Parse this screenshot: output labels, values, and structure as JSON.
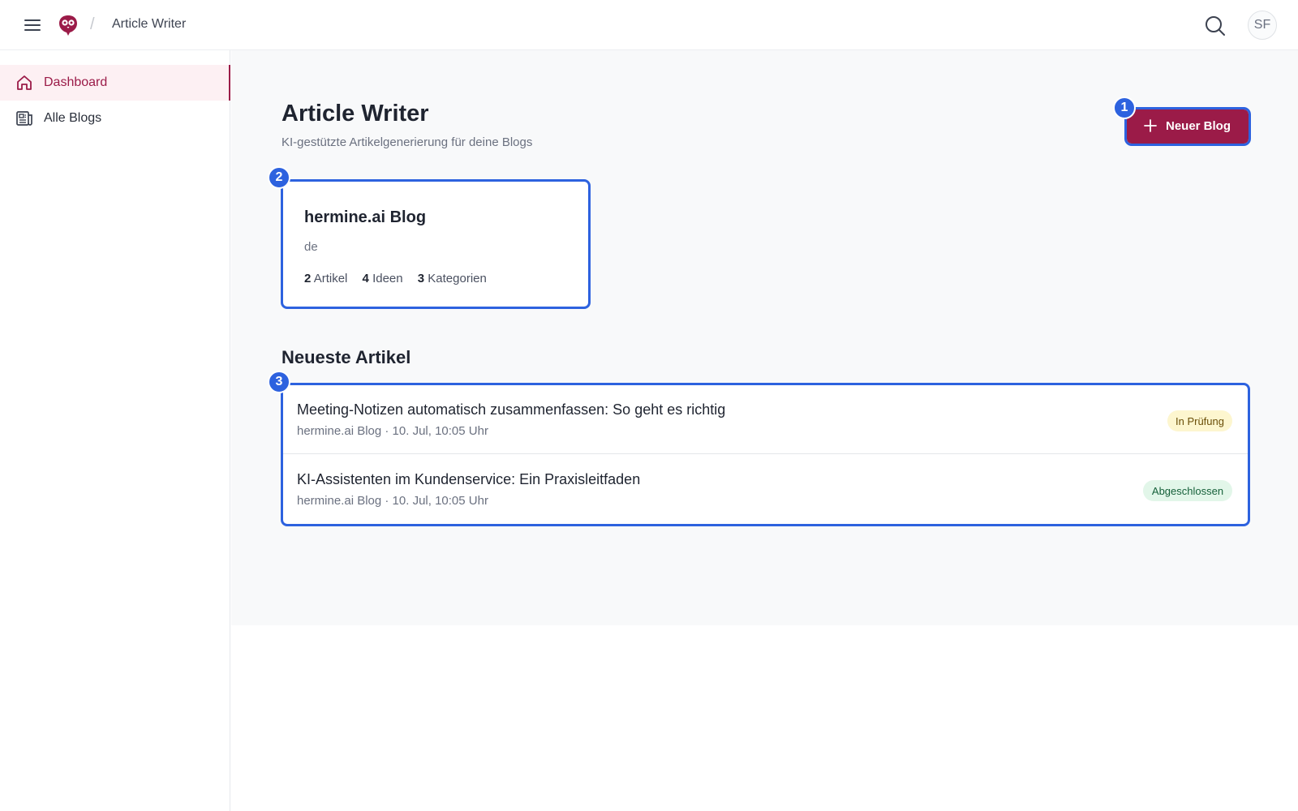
{
  "header": {
    "breadcrumb_separator": "/",
    "breadcrumb_title": "Article Writer",
    "avatar_initials": "SF"
  },
  "sidebar": {
    "items": [
      {
        "label": "Dashboard",
        "icon": "home-icon",
        "active": true
      },
      {
        "label": "Alle Blogs",
        "icon": "newspaper-icon",
        "active": false
      }
    ]
  },
  "page": {
    "title": "Article Writer",
    "subtitle": "KI-gestützte Artikelgenerierung für deine Blogs",
    "new_blog_label": "Neuer Blog"
  },
  "blog": {
    "name": "hermine.ai Blog",
    "language": "de",
    "stats": {
      "articles_count": "2",
      "articles_label": "Artikel",
      "ideas_count": "4",
      "ideas_label": "Ideen",
      "categories_count": "3",
      "categories_label": "Kategorien"
    }
  },
  "latest": {
    "title": "Neueste Artikel",
    "articles": [
      {
        "title": "Meeting-Notizen automatisch zusammenfassen: So geht es richtig",
        "meta": "hermine.ai Blog · 10. Jul, 10:05 Uhr",
        "status": "In Prüfung"
      },
      {
        "title": "KI-Assistenten im Kundenservice: Ein Praxisleitfaden",
        "meta": "hermine.ai Blog · 10. Jul, 10:05 Uhr",
        "status": "Abgeschlossen"
      }
    ]
  },
  "markers": [
    "1",
    "2",
    "3"
  ],
  "colors": {
    "brand": "#9b1b48",
    "highlight": "#2d62df",
    "status_review_bg": "#fdf6cf",
    "status_done_bg": "#e2f6e9"
  }
}
